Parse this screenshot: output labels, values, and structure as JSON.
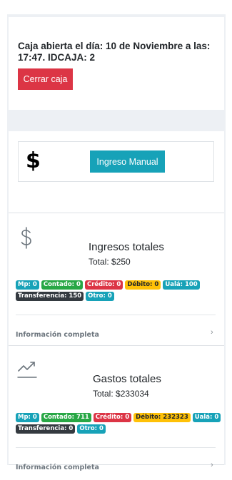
{
  "caja": {
    "status_text": "Caja abierta el día: 10 de Noviembre a las: 17:47. IDCAJA: 2",
    "close_button": "Cerrar caja"
  },
  "ingreso": {
    "icon_glyph": "$",
    "button_label": "Ingreso Manual"
  },
  "ingresos": {
    "icon": "dollar-icon",
    "title": "Ingresos totales",
    "total": "Total: $250",
    "badges": [
      {
        "label": "Mp: 0",
        "color": "info"
      },
      {
        "label": "Contado: 0",
        "color": "success"
      },
      {
        "label": "Crédito: 0",
        "color": "danger"
      },
      {
        "label": "Débito: 0",
        "color": "warning"
      },
      {
        "label": "Ualá: 100",
        "color": "info"
      },
      {
        "label": "Transferencia: 150",
        "color": "dark"
      },
      {
        "label": "Otro: 0",
        "color": "info"
      }
    ],
    "footer_link": "Información completa"
  },
  "gastos": {
    "icon": "trend-line-icon",
    "title": "Gastos totales",
    "total": "Total: $233034",
    "badges": [
      {
        "label": "Mp: 0",
        "color": "info"
      },
      {
        "label": "Contado: 711",
        "color": "success"
      },
      {
        "label": "Crédito: 0",
        "color": "danger"
      },
      {
        "label": "Débito: 232323",
        "color": "warning"
      },
      {
        "label": "Ualá: 0",
        "color": "info"
      },
      {
        "label": "Transferencia: 0",
        "color": "dark"
      },
      {
        "label": "Otro: 0",
        "color": "info"
      }
    ],
    "footer_link": "Información completa"
  },
  "colors": {
    "info": "#17a2b8",
    "success": "#28a745",
    "danger": "#dc3545",
    "warning": "#ffc107",
    "dark": "#343a40"
  }
}
